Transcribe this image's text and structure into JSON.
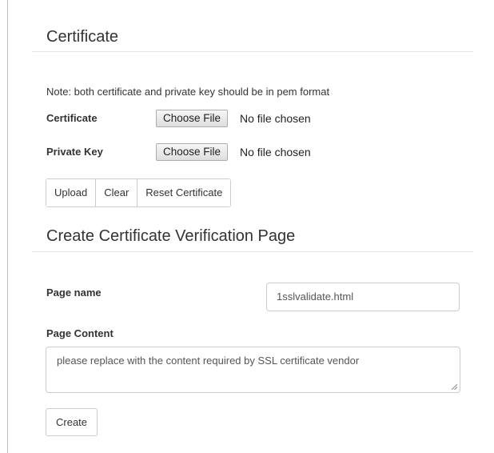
{
  "certificate_section": {
    "title": "Certificate",
    "note": "Note: both certificate and private key should be in pem format",
    "certificate": {
      "label": "Certificate",
      "button": "Choose File",
      "status": "No file chosen"
    },
    "private_key": {
      "label": "Private Key",
      "button": "Choose File",
      "status": "No file chosen"
    },
    "actions": {
      "upload": "Upload",
      "clear": "Clear",
      "reset": "Reset Certificate"
    }
  },
  "verification_section": {
    "title": "Create Certificate Verification Page",
    "page_name": {
      "label": "Page name",
      "value": "1sslvalidate.html"
    },
    "page_content": {
      "label": "Page Content",
      "value": "please replace with the content required by SSL certificate vendor"
    },
    "create_label": "Create"
  }
}
